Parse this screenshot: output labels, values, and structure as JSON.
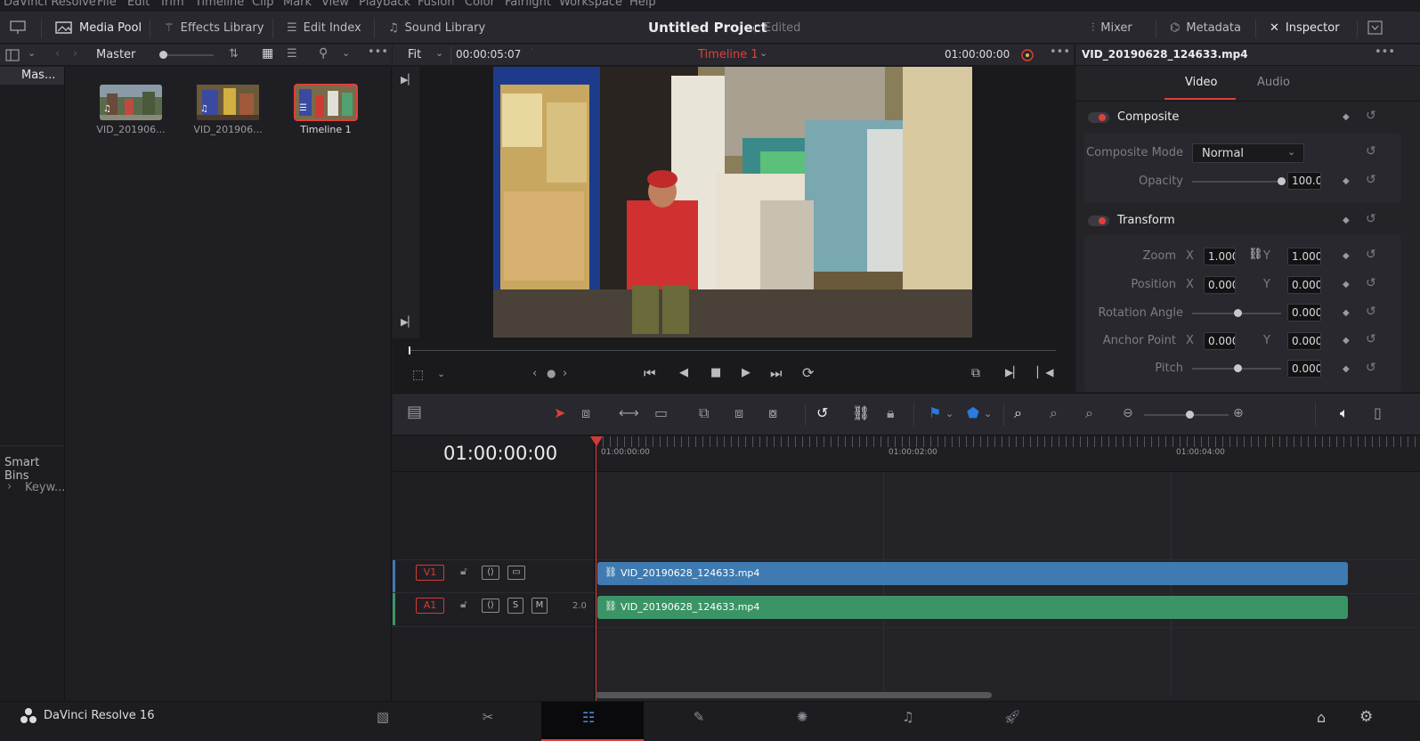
{
  "app": {
    "name": "DaVinci Resolve",
    "version_label": "DaVinci Resolve 16"
  },
  "menu": [
    "DaVinci Resolve",
    "File",
    "Edit",
    "Trim",
    "Timeline",
    "Clip",
    "Mark",
    "View",
    "Playback",
    "Fusion",
    "Color",
    "Fairlight",
    "Workspace",
    "Help"
  ],
  "toolbar": {
    "media_pool": "Media Pool",
    "effects_library": "Effects Library",
    "edit_index": "Edit Index",
    "sound_library": "Sound Library",
    "project_title": "Untitled Project",
    "project_status": "Edited",
    "mixer": "Mixer",
    "metadata": "Metadata",
    "inspector": "Inspector"
  },
  "media_pool": {
    "bin_title": "Master",
    "bins": [
      "Mas..."
    ],
    "smart_bins_title": "Smart Bins",
    "smart_bins": [
      "Keyw..."
    ],
    "clips": [
      {
        "label": "VID_201906..."
      },
      {
        "label": "VID_201906..."
      },
      {
        "label": "Timeline 1"
      }
    ]
  },
  "viewer": {
    "zoom": "Fit",
    "source_timecode": "00:00:05:07",
    "timeline_name": "Timeline 1",
    "record_timecode": "01:00:00:00"
  },
  "inspector": {
    "clip_name": "VID_20190628_124633.mp4",
    "tabs": [
      "Video",
      "Audio"
    ],
    "active_tab": "Video",
    "composite": {
      "title": "Composite",
      "mode_label": "Composite Mode",
      "mode_value": "Normal",
      "opacity_label": "Opacity",
      "opacity_value": "100.00"
    },
    "transform": {
      "title": "Transform",
      "zoom_label": "Zoom",
      "zoom_x": "1.000",
      "zoom_y": "1.000",
      "position_label": "Position",
      "position_x": "0.000",
      "position_y": "0.000",
      "rotation_label": "Rotation Angle",
      "rotation_value": "0.000",
      "anchor_label": "Anchor Point",
      "anchor_x": "0.000",
      "anchor_y": "0.000",
      "pitch_label": "Pitch",
      "pitch_value": "0.000",
      "x": "X",
      "y": "Y"
    }
  },
  "timeline": {
    "timecode": "01:00:00:00",
    "ruler": [
      "01:00:00:00",
      "01:00:02:00",
      "01:00:04:00"
    ],
    "tracks": [
      {
        "id": "V1",
        "clip": "VID_20190628_124633.mp4",
        "color": "#3f7ab0"
      },
      {
        "id": "A1",
        "clip": "VID_20190628_124633.mp4",
        "color": "#3a9466",
        "channels": "2.0",
        "solo": "S",
        "mute": "M"
      }
    ]
  },
  "colors": {
    "accent_red": "#e0403a",
    "playhead": "#d63a35"
  }
}
